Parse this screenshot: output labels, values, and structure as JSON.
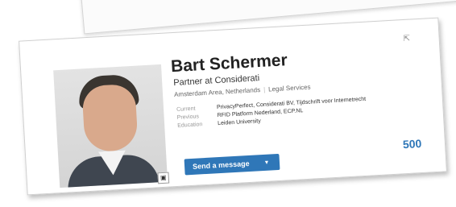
{
  "profile": {
    "name": "Bart Schermer",
    "headline": "Partner at Considerati",
    "location": "Amsterdam Area, Netherlands",
    "industry": "Legal Services",
    "details": [
      {
        "label": "Current",
        "value": "PrivacyPerfect, Considerati BV, Tijdschrift voor Internetrecht"
      },
      {
        "label": "Previous",
        "value": "RFID Platform Nederland, ECP.NL"
      },
      {
        "label": "Education",
        "value": "Leiden University"
      }
    ],
    "send_button": "Send a message",
    "connections": "500",
    "share_icon": "share-icon"
  },
  "colors": {
    "accent": "#2f77b8"
  }
}
